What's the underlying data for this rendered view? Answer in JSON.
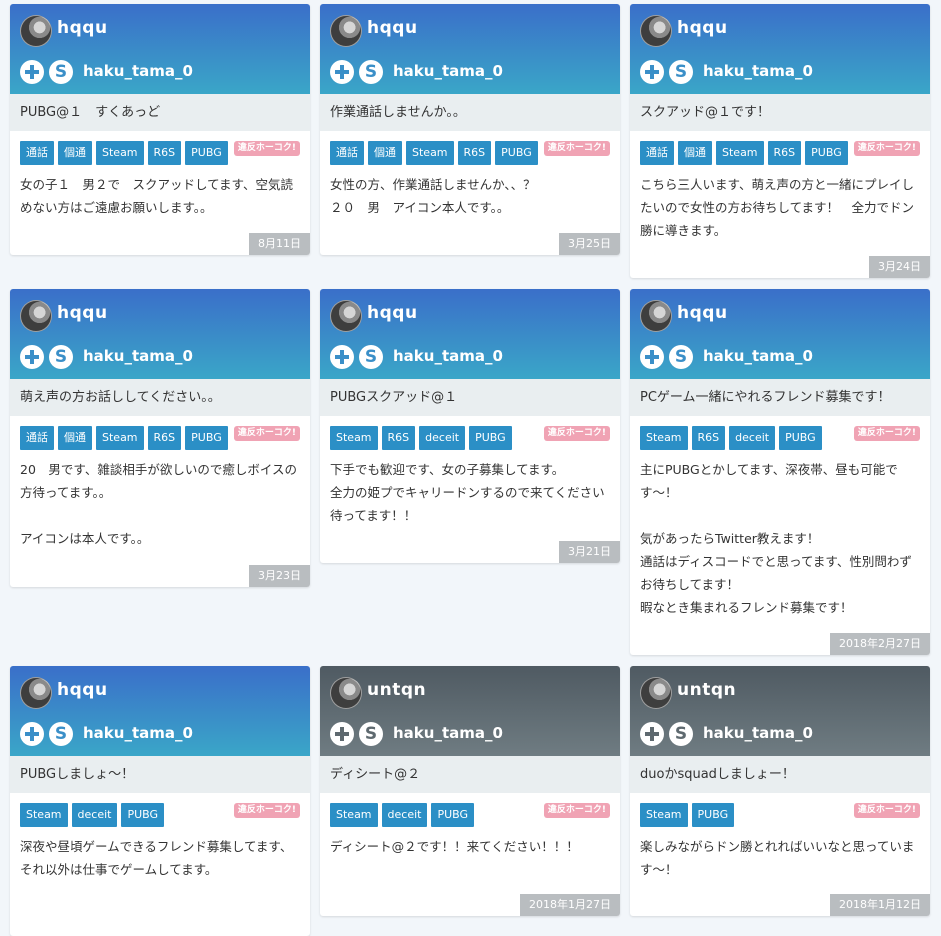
{
  "cards": [
    {
      "username": "hqqu",
      "skype_id": "haku_tama_0",
      "title": "PUBG@１　すくあっど",
      "tags": [
        "通話",
        "個通",
        "Steam",
        "R6S",
        "PUBG"
      ],
      "report": "違反ホーコク!",
      "text": "女の子１　男２で　スクアッドしてます、空気読めない方はご遠慮お願いします。。",
      "date": "8月11日",
      "header": "blue"
    },
    {
      "username": "hqqu",
      "skype_id": "haku_tama_0",
      "title": "作業通話しませんか。。",
      "tags": [
        "通話",
        "個通",
        "Steam",
        "R6S",
        "PUBG"
      ],
      "report": "違反ホーコク!",
      "text": "女性の方、作業通話しませんか、、？\n２０　男　アイコン本人です。。",
      "date": "3月25日",
      "header": "blue"
    },
    {
      "username": "hqqu",
      "skype_id": "haku_tama_0",
      "title": "スクアッド@１です！",
      "tags": [
        "通話",
        "個通",
        "Steam",
        "R6S",
        "PUBG"
      ],
      "report": "違反ホーコク!",
      "text": "こちら三人います、萌え声の方と一緒にプレイしたいので女性の方お待ちしてます！　全力でドン勝に導きます。",
      "date": "3月24日",
      "header": "blue"
    },
    {
      "username": "hqqu",
      "skype_id": "haku_tama_0",
      "title": "萌え声の方お話ししてください。。",
      "tags": [
        "通話",
        "個通",
        "Steam",
        "R6S",
        "PUBG"
      ],
      "report": "違反ホーコク!",
      "text": "20　男です、雑談相手が欲しいので癒しボイスの方待ってます。。\n\nアイコンは本人です。。",
      "date": "3月23日",
      "header": "blue"
    },
    {
      "username": "hqqu",
      "skype_id": "haku_tama_0",
      "title": "PUBGスクアッド@１",
      "tags": [
        "Steam",
        "R6S",
        "deceit",
        "PUBG"
      ],
      "report": "違反ホーコク!",
      "text": "下手でも歓迎です、女の子募集してます。\n全力の姫プでキャリードンするので来てください待ってます！！",
      "date": "3月21日",
      "header": "blue"
    },
    {
      "username": "hqqu",
      "skype_id": "haku_tama_0",
      "title": "PCゲーム一緒にやれるフレンド募集です！",
      "tags": [
        "Steam",
        "R6S",
        "deceit",
        "PUBG"
      ],
      "report": "違反ホーコク!",
      "text": "主にPUBGとかしてます、深夜帯、昼も可能です〜！\n\n気があったらTwitter教えます！\n通話はディスコードでと思ってます、性別問わずお待ちしてます！\n暇なとき集まれるフレンド募集です！",
      "date": "2018年2月27日",
      "header": "blue"
    },
    {
      "username": "hqqu",
      "skype_id": "haku_tama_0",
      "title": "PUBGしましょ〜！",
      "tags": [
        "Steam",
        "deceit",
        "PUBG"
      ],
      "report": "違反ホーコク!",
      "text": "深夜や昼頃ゲームできるフレンド募集してます、\nそれ以外は仕事でゲームしてます。",
      "date": "",
      "header": "blue"
    },
    {
      "username": "untqn",
      "skype_id": "haku_tama_0",
      "title": "ディシート@２",
      "tags": [
        "Steam",
        "deceit",
        "PUBG"
      ],
      "report": "違反ホーコク!",
      "text": "ディシート@２です！！来てください！！！",
      "date": "2018年1月27日",
      "header": "gray"
    },
    {
      "username": "untqn",
      "skype_id": "haku_tama_0",
      "title": "duoかsquadしましょー！",
      "tags": [
        "Steam",
        "PUBG"
      ],
      "report": "違反ホーコク!",
      "text": "楽しみながらドン勝とれればいいなと思っています〜！",
      "date": "2018年1月12日",
      "header": "gray"
    }
  ]
}
